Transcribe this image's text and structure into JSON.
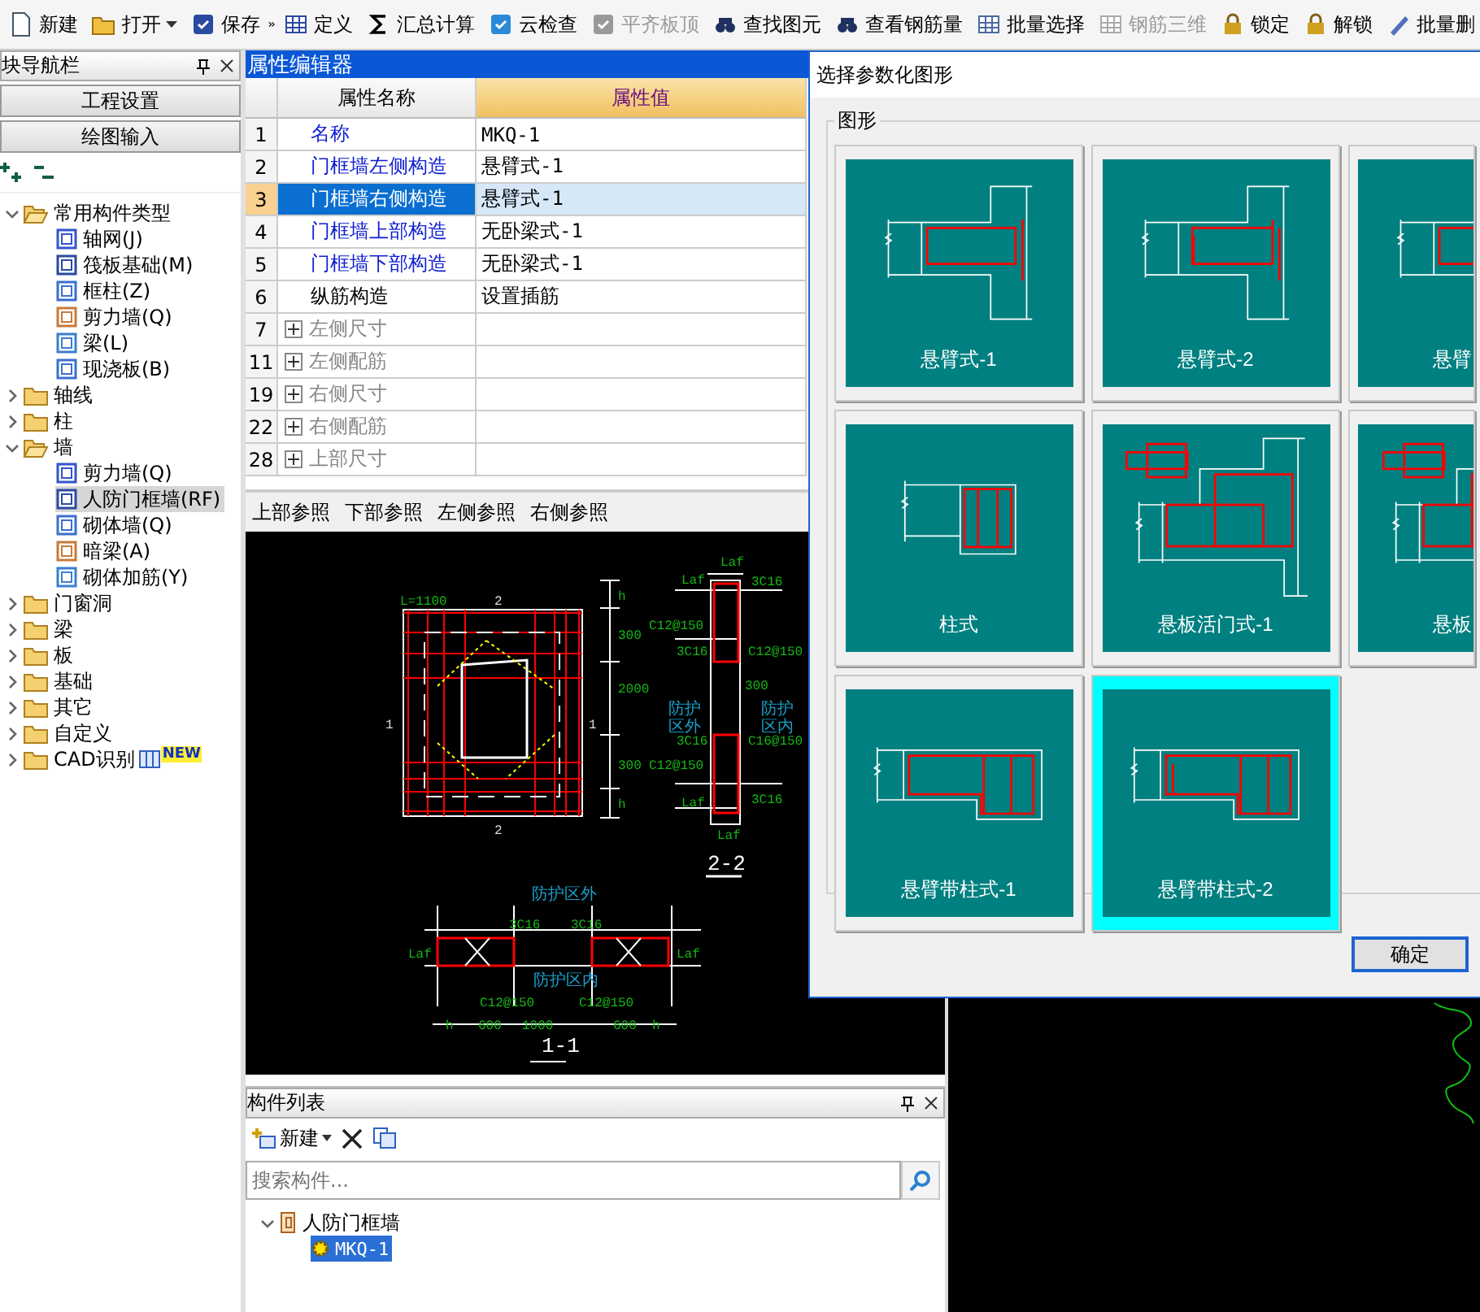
{
  "toolbar": {
    "left": [
      {
        "label": "新建",
        "dropdown": false,
        "disabled": false
      },
      {
        "label": "打开",
        "dropdown": true,
        "disabled": false
      },
      {
        "label": "保存",
        "dropdown": false,
        "disabled": false
      }
    ],
    "right": [
      {
        "label": "定义",
        "dropdown": false,
        "disabled": false
      },
      {
        "label": "汇总计算",
        "dropdown": false,
        "disabled": false
      },
      {
        "label": "云检查",
        "dropdown": false,
        "disabled": false
      },
      {
        "label": "平齐板顶",
        "dropdown": false,
        "disabled": true
      },
      {
        "label": "查找图元",
        "dropdown": false,
        "disabled": false
      },
      {
        "label": "查看钢筋量",
        "dropdown": false,
        "disabled": false
      },
      {
        "label": "批量选择",
        "dropdown": false,
        "disabled": false
      },
      {
        "label": "钢筋三维",
        "dropdown": false,
        "disabled": true
      },
      {
        "label": "锁定",
        "dropdown": false,
        "disabled": false
      },
      {
        "label": "解锁",
        "dropdown": false,
        "disabled": false
      },
      {
        "label": "批量删",
        "dropdown": false,
        "disabled": false
      }
    ]
  },
  "nav": {
    "title": "块导航栏",
    "buttons": [
      "工程设置",
      "绘图输入"
    ],
    "tree": [
      {
        "kind": "folder",
        "label": "常用构件类型",
        "expanded": true,
        "selected": false,
        "children": [
          {
            "kind": "item",
            "label": "轴网(J)",
            "selected": false
          },
          {
            "kind": "item",
            "label": "筏板基础(M)",
            "selected": false
          },
          {
            "kind": "item",
            "label": "框柱(Z)",
            "selected": false
          },
          {
            "kind": "item",
            "label": "剪力墙(Q)",
            "selected": false
          },
          {
            "kind": "item",
            "label": "梁(L)",
            "selected": false
          },
          {
            "kind": "item",
            "label": "现浇板(B)",
            "selected": false
          }
        ]
      },
      {
        "kind": "folder",
        "label": "轴线",
        "expanded": false,
        "selected": false
      },
      {
        "kind": "folder",
        "label": "柱",
        "expanded": false,
        "selected": false
      },
      {
        "kind": "folder",
        "label": "墙",
        "expanded": true,
        "selected": false,
        "children": [
          {
            "kind": "item",
            "label": "剪力墙(Q)",
            "selected": false
          },
          {
            "kind": "item",
            "label": "人防门框墙(RF)",
            "selected": true
          },
          {
            "kind": "item",
            "label": "砌体墙(Q)",
            "selected": false
          },
          {
            "kind": "item",
            "label": "暗梁(A)",
            "selected": false
          },
          {
            "kind": "item",
            "label": "砌体加筋(Y)",
            "selected": false
          }
        ]
      },
      {
        "kind": "folder",
        "label": "门窗洞",
        "expanded": false,
        "selected": false
      },
      {
        "kind": "folder",
        "label": "梁",
        "expanded": false,
        "selected": false
      },
      {
        "kind": "folder",
        "label": "板",
        "expanded": false,
        "selected": false
      },
      {
        "kind": "folder",
        "label": "基础",
        "expanded": false,
        "selected": false
      },
      {
        "kind": "folder",
        "label": "其它",
        "expanded": false,
        "selected": false
      },
      {
        "kind": "folder",
        "label": "自定义",
        "expanded": false,
        "selected": false
      },
      {
        "kind": "folder",
        "label": "CAD识别",
        "expanded": false,
        "selected": false,
        "badge": "NEW"
      }
    ]
  },
  "properties": {
    "title": "属性编辑器",
    "columns": [
      "属性名称",
      "属性值"
    ],
    "rows": [
      {
        "num": "1",
        "name": "名称",
        "value": "MKQ-1",
        "kind": "link",
        "selected": false
      },
      {
        "num": "2",
        "name": "门框墙左侧构造",
        "value": "悬臂式-1",
        "kind": "link",
        "selected": false
      },
      {
        "num": "3",
        "name": "门框墙右侧构造",
        "value": "悬臂式-1",
        "kind": "link",
        "selected": true
      },
      {
        "num": "4",
        "name": "门框墙上部构造",
        "value": "无卧梁式-1",
        "kind": "link",
        "selected": false
      },
      {
        "num": "5",
        "name": "门框墙下部构造",
        "value": "无卧梁式-1",
        "kind": "link",
        "selected": false
      },
      {
        "num": "6",
        "name": "纵筋构造",
        "value": "设置插筋",
        "kind": "plain",
        "selected": false
      },
      {
        "num": "7",
        "name": "左侧尺寸",
        "kind": "group",
        "expanded": false,
        "selected": false
      },
      {
        "num": "11",
        "name": "左侧配筋",
        "kind": "group",
        "expanded": false,
        "selected": false
      },
      {
        "num": "19",
        "name": "右侧尺寸",
        "kind": "group",
        "expanded": false,
        "selected": false
      },
      {
        "num": "22",
        "name": "右侧配筋",
        "kind": "group",
        "expanded": false,
        "selected": false
      },
      {
        "num": "28",
        "name": "上部尺寸",
        "kind": "group",
        "expanded": false,
        "selected": false
      }
    ],
    "references": [
      "上部参照",
      "下部参照",
      "左侧参照",
      "右侧参照"
    ]
  },
  "cad": {
    "labels": [
      "L=1100",
      "2",
      "2",
      "1",
      "1",
      "h",
      "300",
      "2000",
      "300",
      "h",
      "Laf",
      "Laf",
      "3C16",
      "C12@150",
      "3C16",
      "C12@150",
      "300",
      "防护",
      "区外",
      "防护",
      "区内",
      "3C16",
      "C16@150",
      "C12@150",
      "Laf",
      "3C16",
      "Laf",
      "2-2",
      "防护区外",
      "3C16",
      "3C16",
      "Laf",
      "Laf",
      "防护区内",
      "C12@150",
      "C12@150",
      "h",
      "600",
      "1000",
      "600",
      "h",
      "1-1"
    ]
  },
  "components": {
    "title": "构件列表",
    "new_label": "新建",
    "search_placeholder": "搜索构件...",
    "tree": [
      {
        "label": "人防门框墙",
        "expanded": true,
        "selected": false,
        "children": [
          {
            "label": "MKQ-1",
            "selected": true
          }
        ]
      }
    ]
  },
  "dialog": {
    "title": "选择参数化图形",
    "group": "图形",
    "ok": "确定",
    "shapes": [
      {
        "label": "悬臂式-1",
        "kind": "cantilever-1",
        "selected": false
      },
      {
        "label": "悬臂式-2",
        "kind": "cantilever-2",
        "selected": false
      },
      {
        "label": "悬臂",
        "kind": "cantilever-1",
        "selected": false
      },
      {
        "label": "柱式",
        "kind": "column",
        "selected": false
      },
      {
        "label": "悬板活门式-1",
        "kind": "flap-door",
        "selected": false
      },
      {
        "label": "悬板",
        "kind": "flap-door",
        "selected": false
      },
      {
        "label": "悬臂带柱式-1",
        "kind": "cantilever-column-1",
        "selected": false
      },
      {
        "label": "悬臂带柱式-2",
        "kind": "cantilever-column-2",
        "selected": true
      }
    ]
  }
}
